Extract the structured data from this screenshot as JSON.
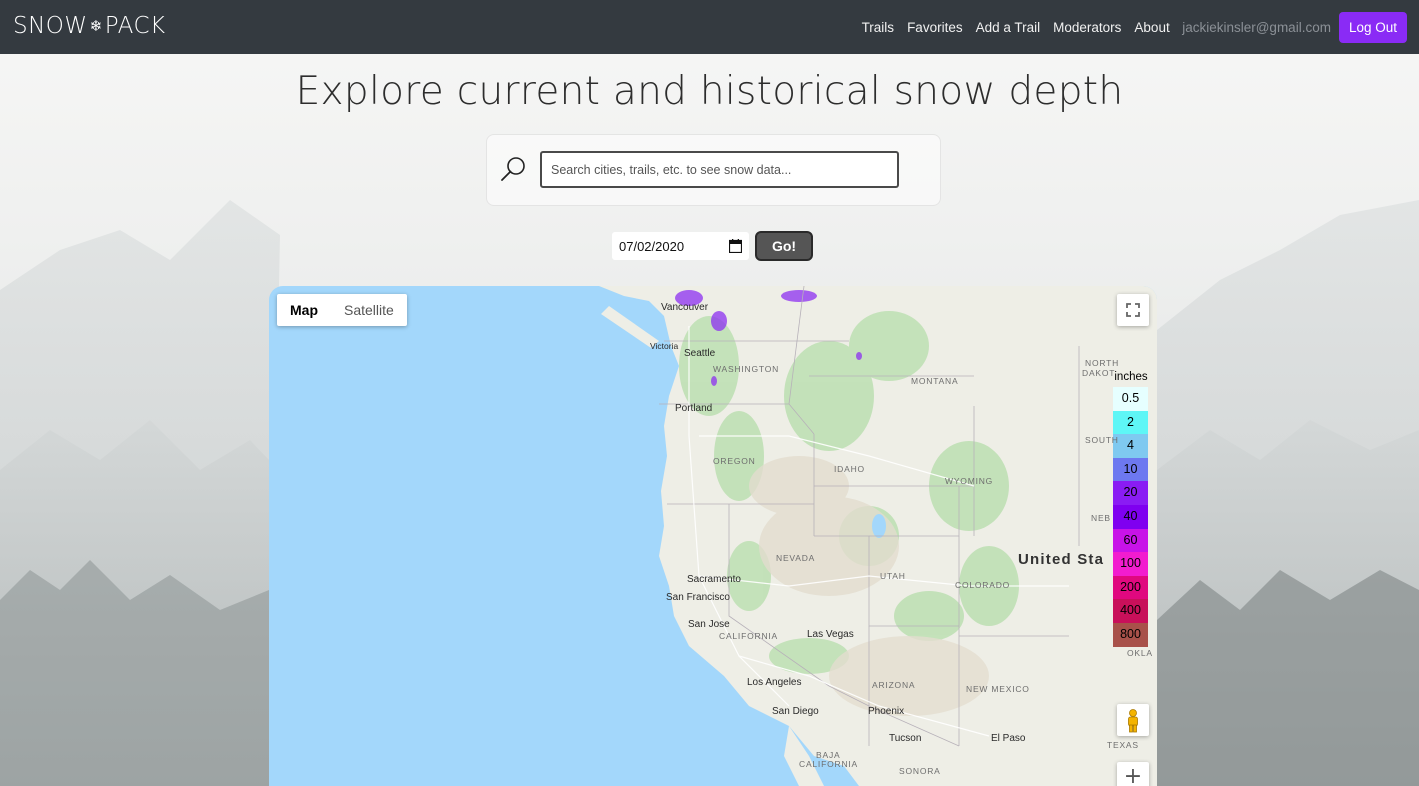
{
  "navbar": {
    "brand_left": "SNOW",
    "brand_icon": "snowflake-icon",
    "brand_right": "PACK",
    "links": [
      "Trails",
      "Favorites",
      "Add a Trail",
      "Moderators",
      "About"
    ],
    "user_email": "jackiekinsler@gmail.com",
    "logout_label": "Log Out",
    "accent_color": "#8a2bf5"
  },
  "header": {
    "title": "Explore current and historical snow depth"
  },
  "search": {
    "icon": "search-icon",
    "placeholder": "Search cities, trails, etc. to see snow data..."
  },
  "date_picker": {
    "value": "07/02/2020",
    "icon": "calendar-icon",
    "go_label": "Go!"
  },
  "map": {
    "map_type_options": [
      "Map",
      "Satellite"
    ],
    "selected_map_type": "Map",
    "fullscreen_icon": "fullscreen-icon",
    "pegman_icon": "pegman-icon",
    "zoom_in_label": "+",
    "state_labels": [
      "WASHINGTON",
      "MONTANA",
      "NORTH",
      "DAKOT",
      "OREGON",
      "IDAHO",
      "WYOMING",
      "SOUTH",
      "NEB",
      "NEVADA",
      "UTAH",
      "COLORADO",
      "CALIFORNIA",
      "ARIZONA",
      "NEW MEXICO",
      "OKLA",
      "TEXAS",
      "BAJA",
      "CALIFORNIA",
      "SONORA"
    ],
    "city_labels": [
      "Vancouver",
      "Victoria",
      "Seattle",
      "Portland",
      "Sacramento",
      "San Francisco",
      "San Jose",
      "Las Vegas",
      "Los Angeles",
      "San Diego",
      "Phoenix",
      "Tucson",
      "El Paso"
    ],
    "country_label": "United Sta",
    "legend": {
      "title": "inches",
      "items": [
        {
          "label": "0.5",
          "color": "#e6ffff"
        },
        {
          "label": "2",
          "color": "#5ef6f6"
        },
        {
          "label": "4",
          "color": "#7fc9f0"
        },
        {
          "label": "10",
          "color": "#6d78f0"
        },
        {
          "label": "20",
          "color": "#8a1cf4"
        },
        {
          "label": "40",
          "color": "#7f00f0"
        },
        {
          "label": "60",
          "color": "#c813e8"
        },
        {
          "label": "100",
          "color": "#f21ccf"
        },
        {
          "label": "200",
          "color": "#e0087f"
        },
        {
          "label": "400",
          "color": "#c8105a"
        },
        {
          "label": "800",
          "color": "#a8514a"
        }
      ]
    }
  }
}
